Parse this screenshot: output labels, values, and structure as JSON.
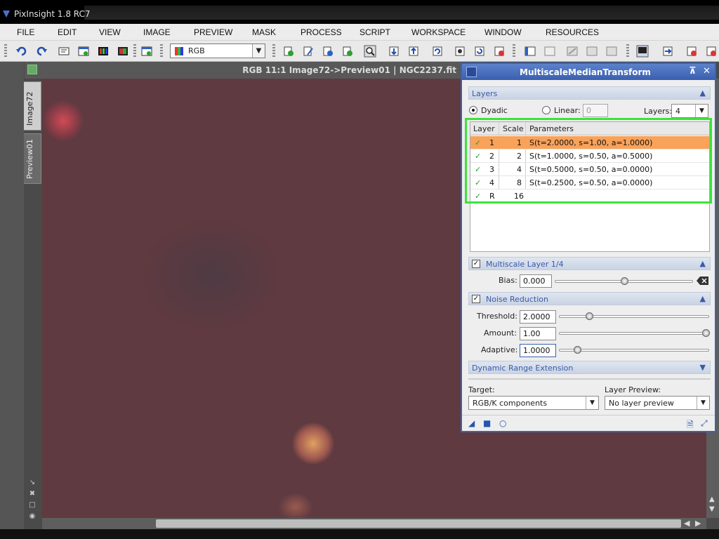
{
  "window": {
    "title": "PixInsight 1.8 RC7"
  },
  "menu": [
    "FILE",
    "EDIT",
    "VIEW",
    "IMAGE",
    "PREVIEW",
    "MASK",
    "PROCESS",
    "SCRIPT",
    "WORKSPACE",
    "WINDOW",
    "RESOURCES"
  ],
  "toolbar": {
    "channel_select": "RGB"
  },
  "document": {
    "title": "RGB 11:1 Image72->Preview01 | NGC2237.fit",
    "tabs": [
      "Image72",
      "Preview01"
    ]
  },
  "panel": {
    "title": "MultiscaleMedianTransform",
    "layers_section": "Layers",
    "dyadic_label": "Dyadic",
    "linear_label": "Linear:",
    "linear_value": "0",
    "layers_label": "Layers:",
    "layers_value": "4",
    "columns": [
      "Layer",
      "Scale",
      "Parameters"
    ],
    "rows": [
      {
        "layer": "1",
        "scale": "1",
        "params": "S(t=2.0000, s=1.00, a=1.0000)",
        "selected": true
      },
      {
        "layer": "2",
        "scale": "2",
        "params": "S(t=1.0000, s=0.50, a=0.5000)",
        "selected": false
      },
      {
        "layer": "3",
        "scale": "4",
        "params": "S(t=0.5000, s=0.50, a=0.0000)",
        "selected": false
      },
      {
        "layer": "4",
        "scale": "8",
        "params": "S(t=0.2500, s=0.50, a=0.0000)",
        "selected": false
      },
      {
        "layer": "R",
        "scale": "16",
        "params": "",
        "selected": false
      }
    ],
    "multiscale_layer": "Multiscale Layer 1/4",
    "bias_label": "Bias:",
    "bias_value": "0.000",
    "noise_reduction": "Noise Reduction",
    "threshold_label": "Threshold:",
    "threshold_value": "2.0000",
    "amount_label": "Amount:",
    "amount_value": "1.00",
    "adaptive_label": "Adaptive:",
    "adaptive_value": "1.0000",
    "dre": "Dynamic Range Extension",
    "target_label": "Target:",
    "target_value": "RGB/K components",
    "preview_label": "Layer Preview:",
    "preview_value": "No layer preview",
    "threshold_level": 0.2,
    "amount_level": 1.0,
    "adaptive_level": 0.12,
    "bias_level": 0.5
  },
  "colors": {
    "accent": "#3b63b0",
    "selection": "#f9a25a",
    "highlight": "#3ce23c",
    "image_bg": "#5f3a40"
  }
}
